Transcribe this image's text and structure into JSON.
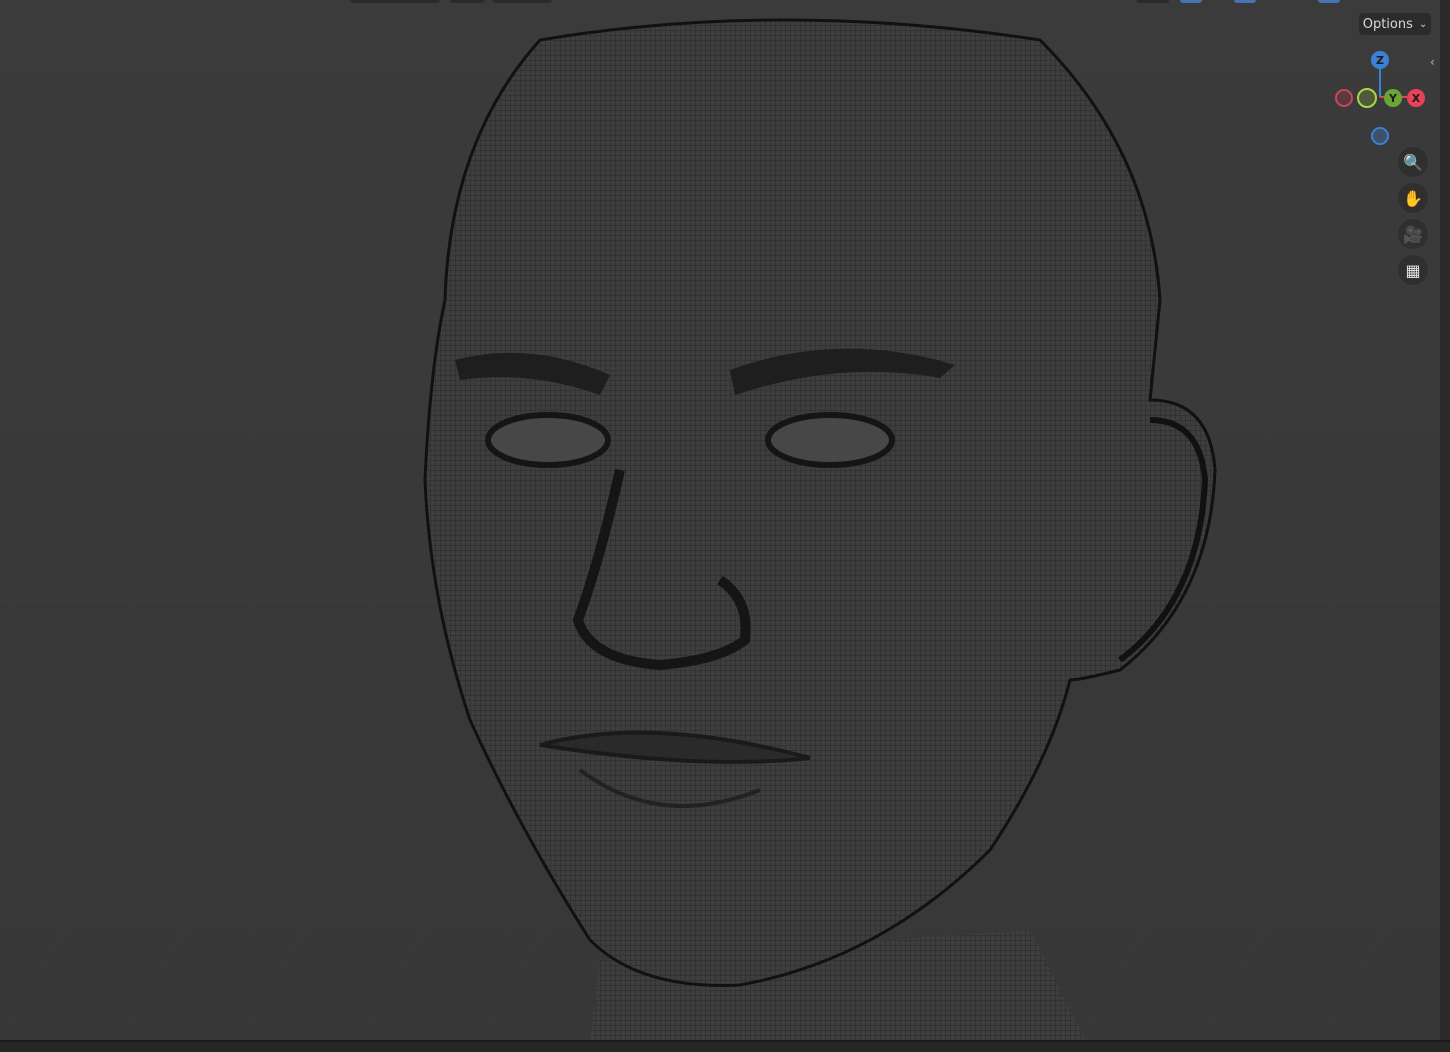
{
  "viewport": {
    "options_label": "Options",
    "options_chevron": "⌄",
    "gizmo": {
      "z_label": "Z",
      "y_label": "Y",
      "x_label": "X"
    },
    "colors": {
      "x": "#e8435a",
      "y": "#6ba536",
      "z": "#3b82d6",
      "background": "#393939"
    },
    "nav_buttons": [
      {
        "icon": "zoom-icon",
        "glyph": "🔍"
      },
      {
        "icon": "hand-pan-icon",
        "glyph": "✋"
      },
      {
        "icon": "camera-icon",
        "glyph": "🎥"
      },
      {
        "icon": "grid-perspective-icon",
        "glyph": "▦"
      }
    ],
    "sidebar_toggle": "‹"
  }
}
